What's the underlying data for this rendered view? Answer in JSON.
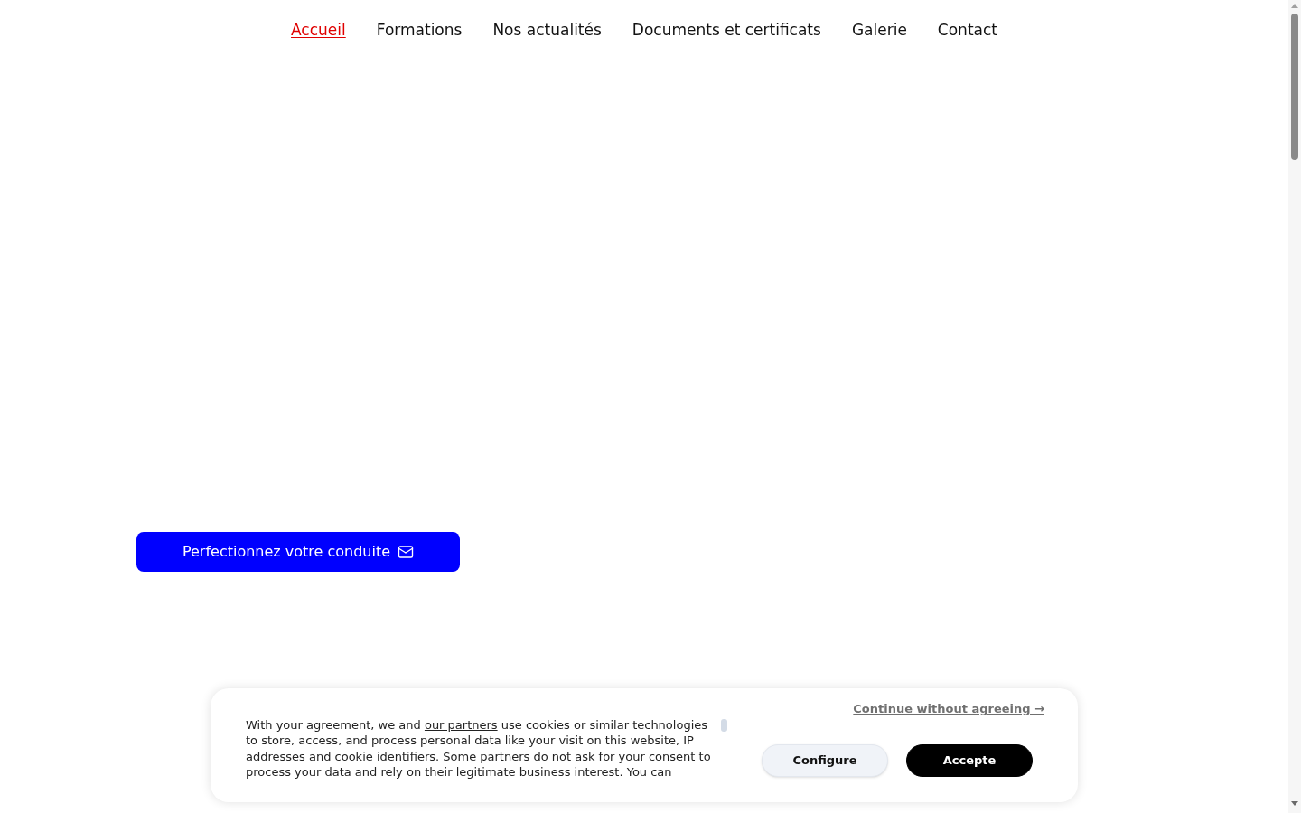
{
  "nav": {
    "items": [
      {
        "label": "Accueil",
        "selected": true
      },
      {
        "label": "Formations",
        "selected": false
      },
      {
        "label": "Nos actualités",
        "selected": false
      },
      {
        "label": "Documents et certificats",
        "selected": false
      },
      {
        "label": "Galerie",
        "selected": false
      },
      {
        "label": "Contact",
        "selected": false
      }
    ]
  },
  "hero": {
    "cta": {
      "label": "Perfectionnez votre conduite"
    }
  },
  "cookie_banner": {
    "message": {
      "before": "With your agreement, we and",
      "link": "our partners",
      "after": "use cookies or similar technologies to store, access, and process personal data like your visit on this website, IP addresses and cookie identifiers. Some partners do not ask for your consent to process your data and rely on their legitimate business interest. You can"
    },
    "skip_link": "Continue without agreeing →",
    "buttons": [
      {
        "label": "Configure",
        "kind": "secondary"
      },
      {
        "label": "Accepte",
        "kind": "primary"
      }
    ]
  }
}
